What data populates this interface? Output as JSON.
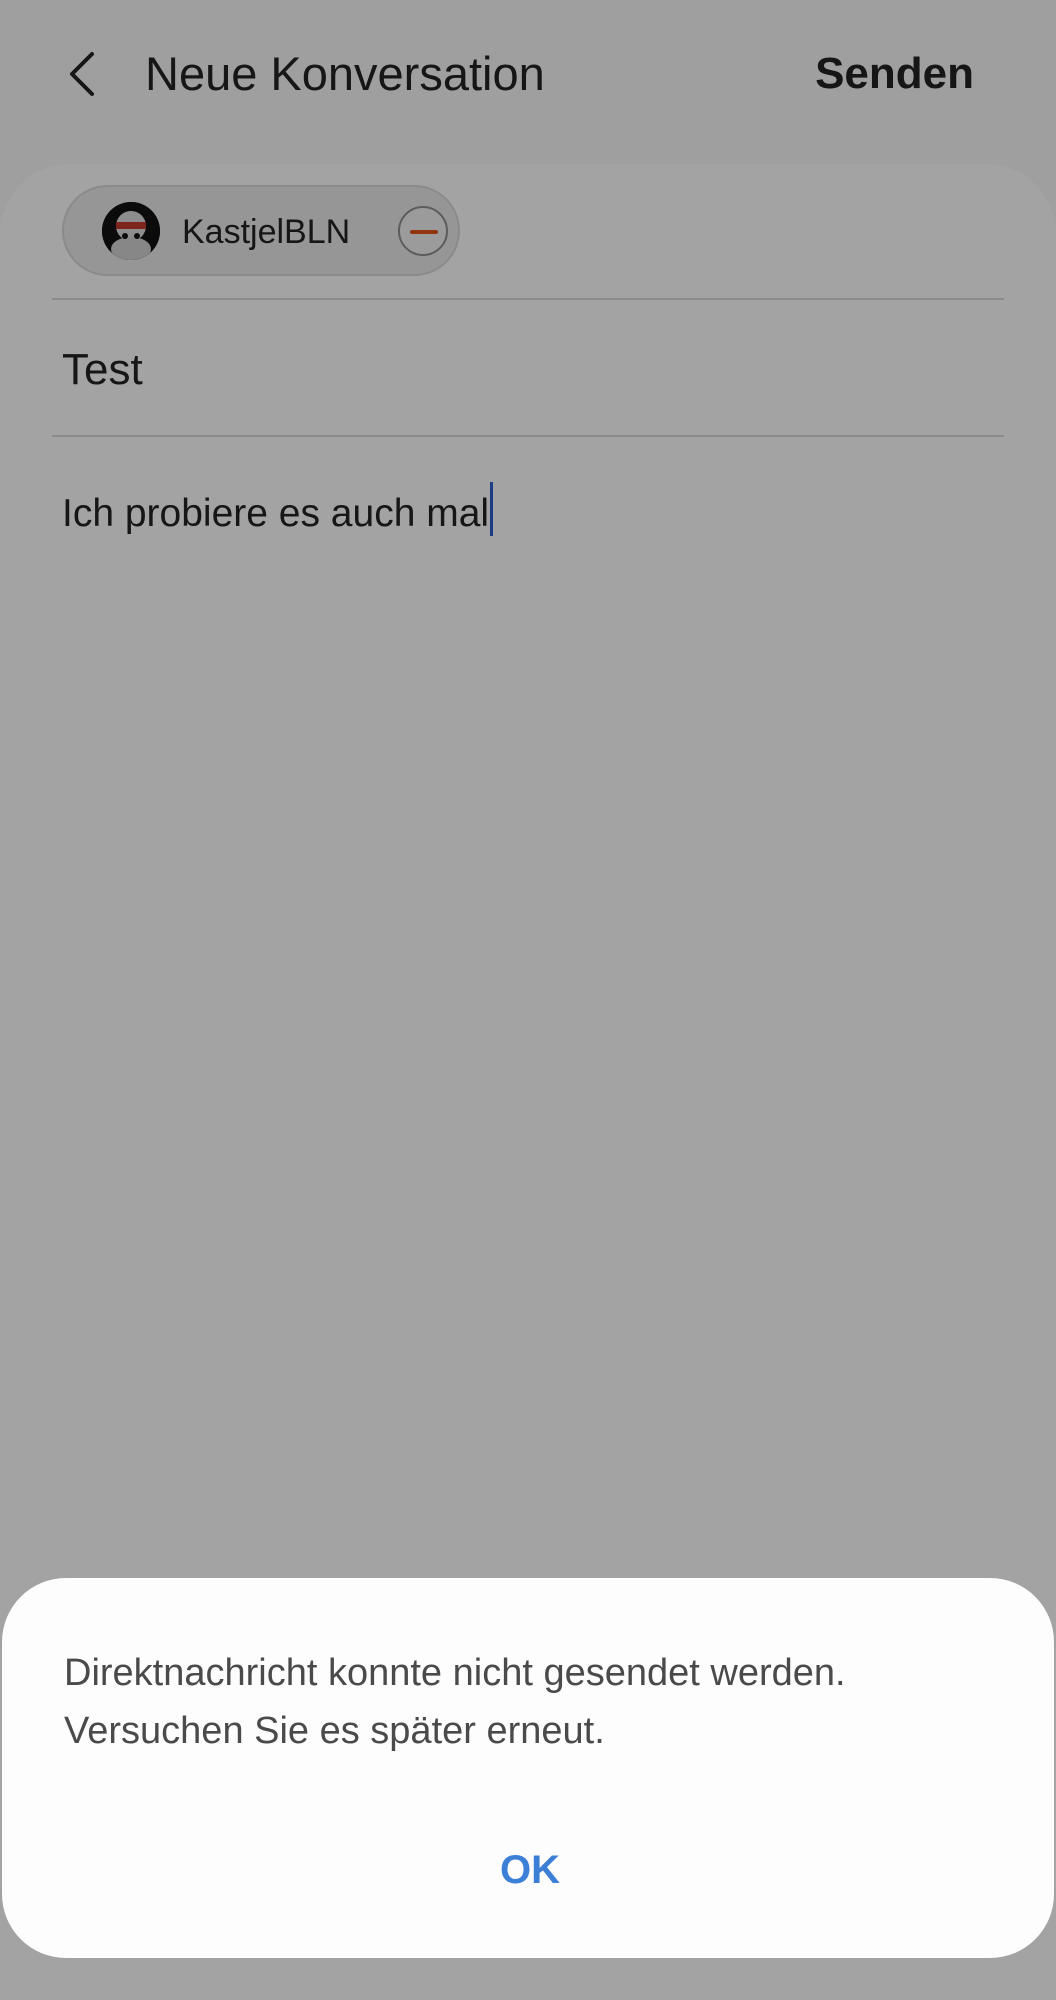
{
  "header": {
    "title": "Neue Konversation",
    "send_label": "Senden"
  },
  "recipient": {
    "name": "KastjelBLN"
  },
  "compose": {
    "subject": "Test",
    "message": "Ich probiere es auch mal"
  },
  "dialog": {
    "message_line1": "Direktnachricht konnte nicht gesendet werden.",
    "message_line2": "Versuchen Sie es später erneut.",
    "ok_label": "OK"
  },
  "icons": {
    "back": "chevron-left-icon",
    "remove": "minus-circle-icon"
  },
  "colors": {
    "accent": "#3b7fd6",
    "remove_bar": "#e0521b",
    "caret": "#2f5fd0"
  }
}
